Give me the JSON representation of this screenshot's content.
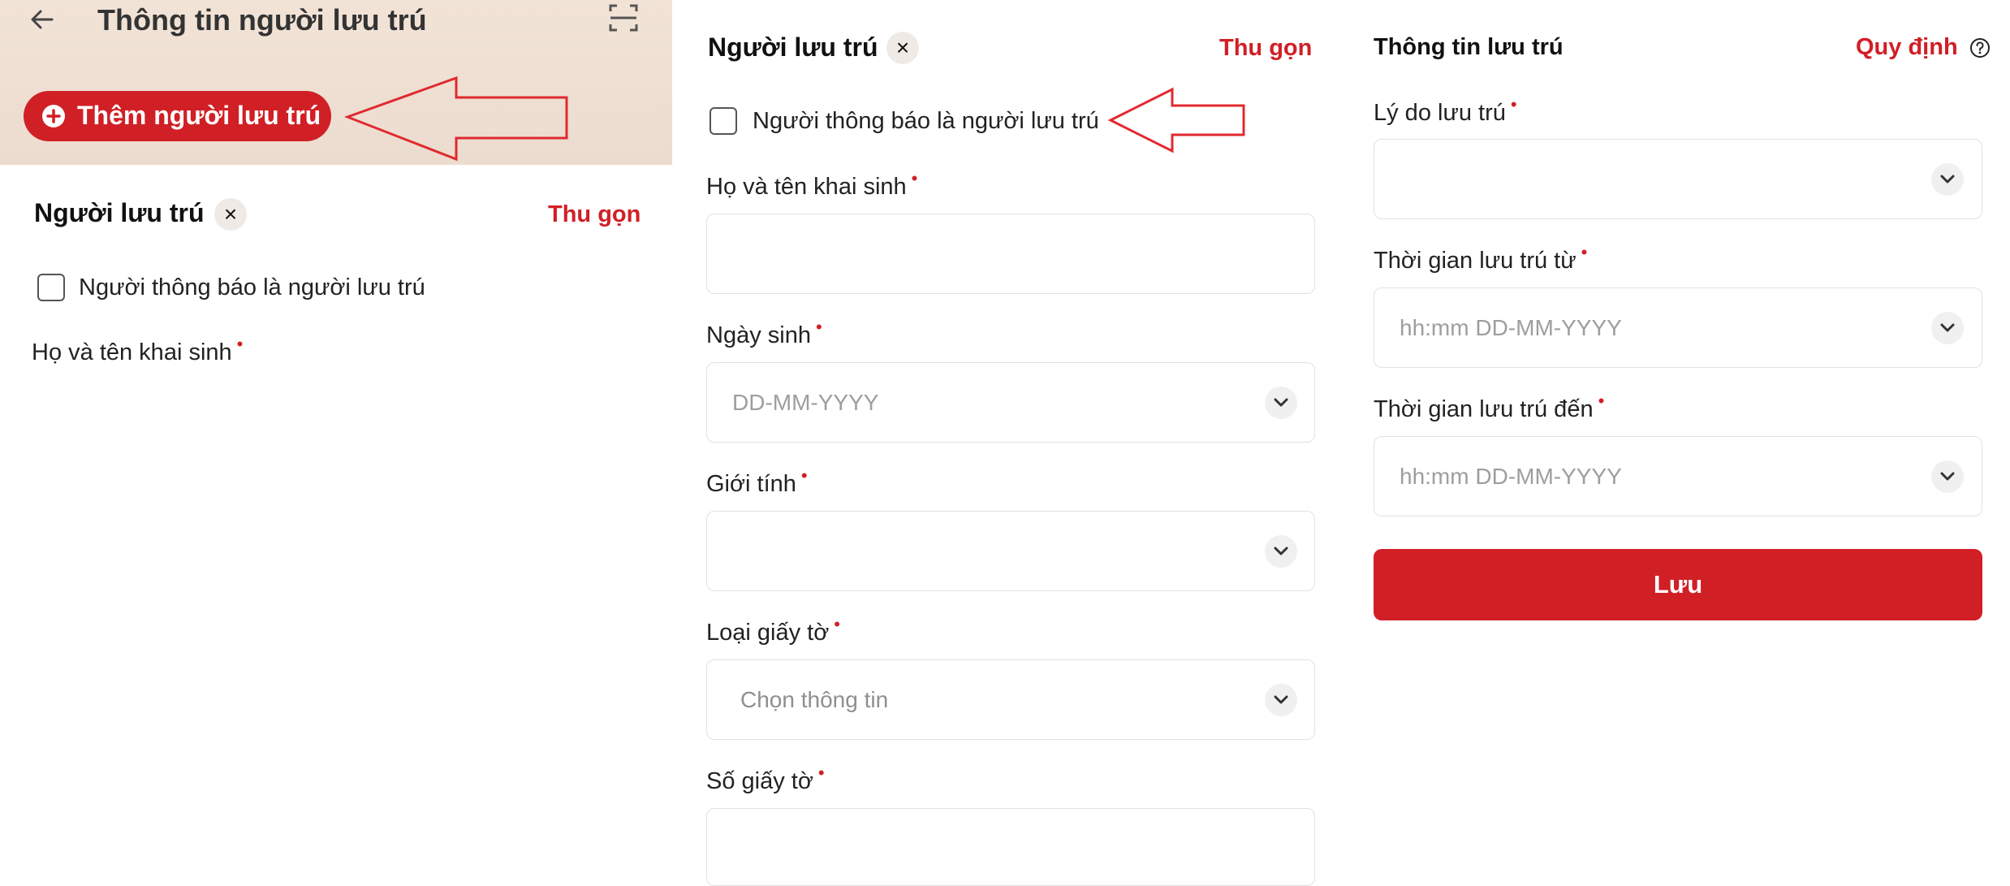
{
  "header": {
    "title": "Thông tin người lưu trú"
  },
  "add_button": {
    "label": "Thêm người lưu trú"
  },
  "guest_section": {
    "title": "Người lưu trú",
    "collapse_label": "Thu gọn",
    "remove_icon": "×",
    "reporter_is_guest_label": "Người thông báo là người lưu trú"
  },
  "fields": {
    "full_name": {
      "label": "Họ và tên khai sinh",
      "value": ""
    },
    "birth_date": {
      "label": "Ngày sinh",
      "placeholder": "DD-MM-YYYY"
    },
    "gender": {
      "label": "Giới tính",
      "value": ""
    },
    "doc_type": {
      "label": "Loại giấy tờ",
      "placeholder": "Chọn thông tin"
    },
    "doc_number": {
      "label": "Số giấy tờ",
      "value": ""
    }
  },
  "stay_info": {
    "title": "Thông tin lưu trú",
    "rules_label": "Quy định",
    "reason": {
      "label": "Lý do lưu trú",
      "value": ""
    },
    "from": {
      "label": "Thời gian lưu trú từ",
      "placeholder": "hh:mm DD-MM-YYYY"
    },
    "to": {
      "label": "Thời gian lưu trú đến",
      "placeholder": "hh:mm DD-MM-YYYY"
    },
    "required_mark": "•"
  },
  "save_button": {
    "label": "Lưu"
  },
  "colors": {
    "accent": "#d11f26",
    "header_bg": "#f2e3d7",
    "border": "#e1e1e1"
  },
  "icons": [
    "back-arrow-icon",
    "scan-icon",
    "plus-circle-icon",
    "close-icon",
    "chevron-down-icon",
    "help-circle-icon",
    "annotation-arrow-icon"
  ]
}
